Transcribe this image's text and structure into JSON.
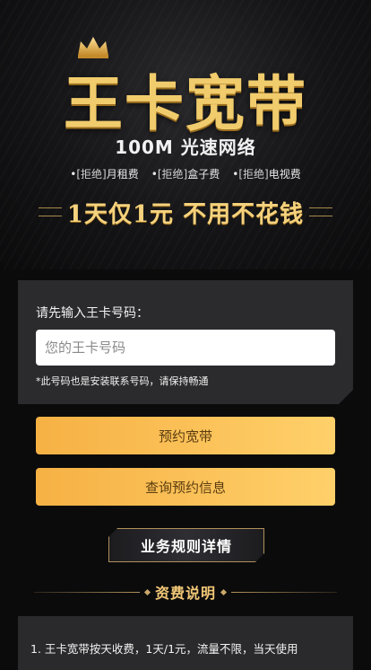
{
  "hero": {
    "brand_title": "王卡宽带",
    "subtitle": "100M 光速网络",
    "features": [
      {
        "tag": "[拒绝]",
        "text": "月租费"
      },
      {
        "tag": "[拒绝]",
        "text": "盒子费"
      },
      {
        "tag": "[拒绝]",
        "text": "电视费"
      }
    ],
    "slogan": "1天仅1元  不用不花钱",
    "icons": {
      "crown": "crown-icon"
    }
  },
  "form": {
    "label": "请先输入王卡号码：",
    "input_placeholder": "您的王卡号码",
    "input_value": "",
    "note": "*此号码也是安装联系号码，请保持畅通"
  },
  "buttons": {
    "reserve": "预约宽带",
    "query": "查询预约信息"
  },
  "rules_link": "业务规则详情",
  "fees": {
    "heading": "资费说明",
    "items": [
      "1. 王卡宽带按天收费，1天/1元，流量不限，当天使用"
    ]
  },
  "colors": {
    "gold": "#f1cc6d",
    "button_start": "#f6b144",
    "button_end": "#ffd06a",
    "background": "#0b0b0c",
    "card": "#2b2b2d"
  }
}
